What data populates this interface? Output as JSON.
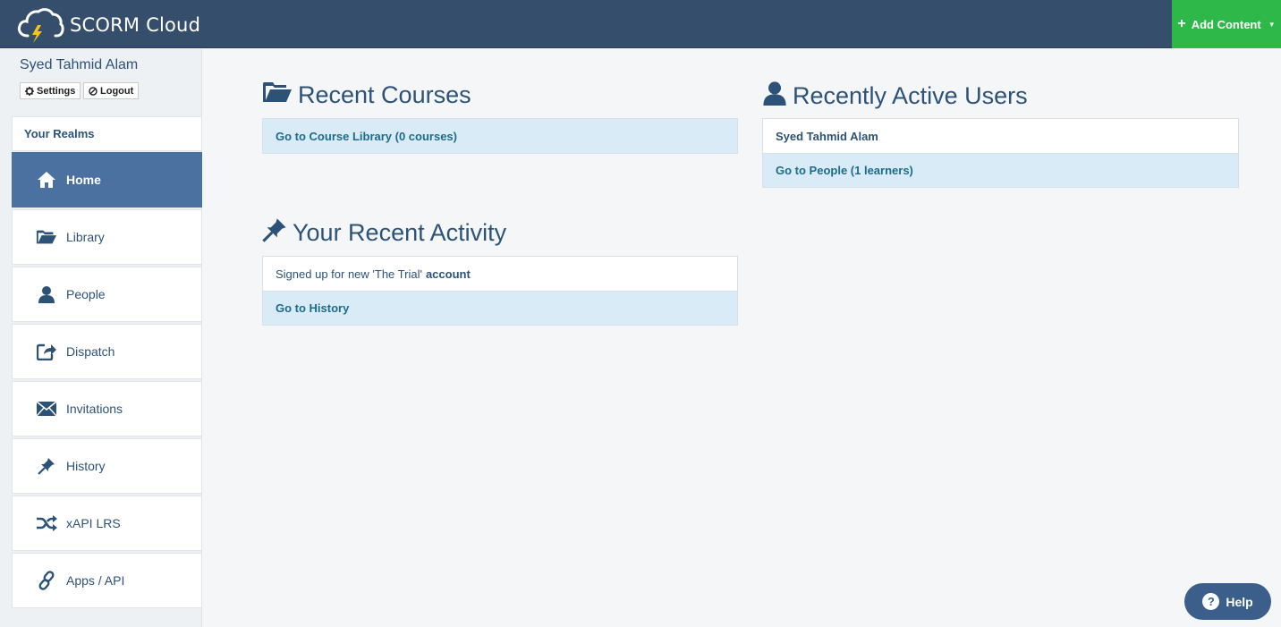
{
  "app": {
    "name": "SCORM Cloud",
    "add_content_label": "Add Content"
  },
  "user": {
    "name": "Syed Tahmid Alam",
    "settings_label": "Settings",
    "logout_label": "Logout"
  },
  "sidebar": {
    "realms_label": "Your Realms",
    "items": [
      {
        "label": "Home",
        "icon": "home-icon",
        "active": true
      },
      {
        "label": "Library",
        "icon": "folder-open-icon"
      },
      {
        "label": "People",
        "icon": "user-icon"
      },
      {
        "label": "Dispatch",
        "icon": "share-icon"
      },
      {
        "label": "Invitations",
        "icon": "envelope-icon"
      },
      {
        "label": "History",
        "icon": "pushpin-icon"
      },
      {
        "label": "xAPI LRS",
        "icon": "shuffle-icon"
      },
      {
        "label": "Apps / API",
        "icon": "link-icon"
      }
    ]
  },
  "recent_courses": {
    "title": "Recent Courses",
    "icon": "folder-open-icon",
    "library_link": "Go to Course Library (0 courses)"
  },
  "recent_users": {
    "title": "Recently Active Users",
    "icon": "user-icon",
    "users": [
      "Syed Tahmid Alam"
    ],
    "people_link": "Go to People (1 learners)"
  },
  "recent_activity": {
    "title": "Your Recent Activity",
    "icon": "pushpin-icon",
    "entry_text": "Signed up for new 'The Trial'",
    "entry_bold": "account",
    "history_link": "Go to History"
  },
  "help": {
    "label": "Help",
    "icon_glyph": "?"
  },
  "colors": {
    "topbar": "#354e6b",
    "accent_green": "#2fb84a",
    "active_nav": "#4a71a0",
    "link_row": "#d9ebf7",
    "heading": "#2d5278"
  }
}
